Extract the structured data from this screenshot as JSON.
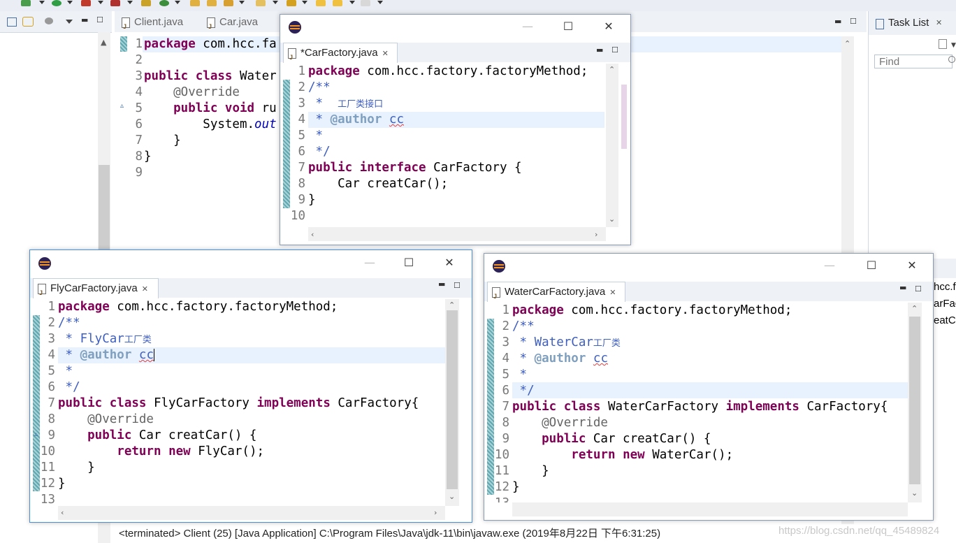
{
  "toolbar": {
    "icons": [
      "debug-icon",
      "run-icon",
      "coverage-icon",
      "external-tools-icon",
      "new-class-icon",
      "open-folder-icon",
      "search-icon",
      "next-annotation-icon",
      "back-icon",
      "forward-icon"
    ]
  },
  "bg_editor": {
    "tabs": [
      {
        "label": "Client.java"
      },
      {
        "label": "Car.java"
      }
    ],
    "line_numbers": [
      "1",
      "2",
      "3",
      "4",
      "5",
      "6",
      "7",
      "8",
      "9"
    ],
    "lines": [
      {
        "kw1": "package",
        "rest": " com.hcc.fa"
      },
      {
        "rest": ""
      },
      {
        "kw1": "public",
        "kw2": "class",
        "rest": " Water"
      },
      {
        "ann": "    @Override"
      },
      {
        "kw1": "    public",
        "kw2": "void",
        "rest": " ru"
      },
      {
        "rest": "        System.",
        "fld": "out"
      },
      {
        "rest": "    }"
      },
      {
        "rest": "}"
      },
      {
        "rest": ""
      }
    ]
  },
  "task_list": {
    "title": "Task List",
    "find_placeholder": "Find"
  },
  "right_edge": {
    "labels": [
      "hcc.f",
      "arFac",
      "eatC"
    ]
  },
  "car_factory": {
    "tab": "*CarFactory.java",
    "line_numbers": [
      "1",
      "2",
      "3",
      "4",
      "5",
      "6",
      "7",
      "8",
      "9",
      "10"
    ],
    "l1_kw": "package",
    "l1_rest": " com.hcc.factory.factoryMethod;",
    "l2": "/**",
    "l3_prefix": " *  ",
    "l3_cjk": "工厂类接口",
    "l4_prefix": " * ",
    "l4_tag": "@author",
    "l4_name": "cc",
    "l5": " *",
    "l6": " */",
    "l7_kw1": "public",
    "l7_kw2": "interface",
    "l7_rest": " CarFactory {",
    "l8": "    Car creatCar();",
    "l9": "}"
  },
  "fly_factory": {
    "tab": "FlyCarFactory.java",
    "line_numbers": [
      "1",
      "2",
      "3",
      "4",
      "5",
      "6",
      "7",
      "8",
      "9",
      "10",
      "11",
      "12",
      "13"
    ],
    "l1_kw": "package",
    "l1_rest": " com.hcc.factory.factoryMethod;",
    "l2": "/**",
    "l3_prefix": " * FlyCar",
    "l3_cjk": "工厂类",
    "l4_prefix": " * ",
    "l4_tag": "@author",
    "l4_name": "cc",
    "l5": " *",
    "l6": " */",
    "l7_kw1": "public",
    "l7_kw2": "class",
    "l7_mid": " FlyCarFactory ",
    "l7_kw3": "implements",
    "l7_rest": " CarFactory{",
    "l8": "    @Override",
    "l9_kw": "    public",
    "l9_rest": " Car creatCar() {",
    "l10_kw1": "        return",
    "l10_kw2": "new",
    "l10_rest": " FlyCar();",
    "l11": "    }",
    "l12": "}"
  },
  "water_factory": {
    "tab": "WaterCarFactory.java",
    "line_numbers": [
      "1",
      "2",
      "3",
      "4",
      "5",
      "6",
      "7",
      "8",
      "9",
      "10",
      "11",
      "12",
      "13"
    ],
    "l1_kw": "package",
    "l1_rest": " com.hcc.factory.factoryMethod;",
    "l2": "/**",
    "l3_prefix": " * WaterCar",
    "l3_cjk": "工厂类",
    "l4_prefix": " * ",
    "l4_tag": "@author",
    "l4_name": "cc",
    "l5": " *",
    "l6": " */",
    "l7_kw1": "public",
    "l7_kw2": "class",
    "l7_mid": " WaterCarFactory ",
    "l7_kw3": "implements",
    "l7_rest": " CarFactory{",
    "l8": "    @Override",
    "l9_kw": "    public",
    "l9_rest": " Car creatCar() {",
    "l10_kw1": "        return",
    "l10_kw2": "new",
    "l10_rest": " WaterCar();",
    "l11": "    }",
    "l12": "}"
  },
  "console": {
    "status": "<terminated> Client (25) [Java Application] C:\\Program Files\\Java\\jdk-11\\bin\\javaw.exe (2019年8月22日 下午6:31:25)"
  },
  "watermark": "https://blog.csdn.net/qq_45489824",
  "window_buttons": {
    "minimize": "—",
    "maximize": "☐",
    "close": "✕"
  },
  "colors": {
    "keyword": "#7f0055",
    "comment": "#3f5fbf",
    "annotation": "#646464",
    "field": "#0000c0",
    "line_highlight": "#e8f2fe"
  }
}
